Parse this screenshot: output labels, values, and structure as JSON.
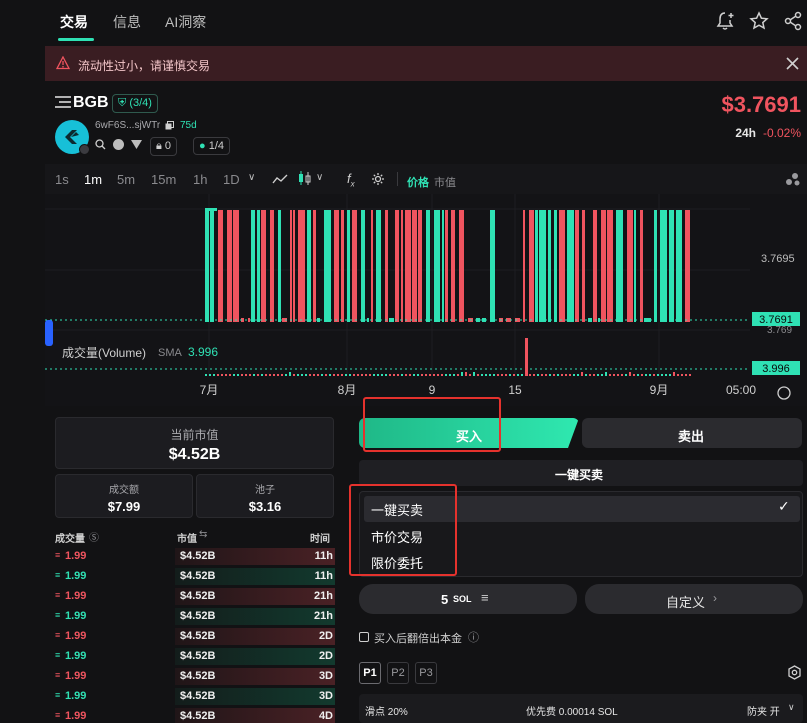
{
  "topbar": {
    "tabs": [
      {
        "label": "交易"
      },
      {
        "label": "信息"
      },
      {
        "label": "AI洞察"
      }
    ],
    "icons": [
      "bell-plus-icon",
      "star-icon",
      "share-icon"
    ]
  },
  "warning": {
    "text": "流动性过小，请谨慎交易",
    "icon": "warning-triangle-icon"
  },
  "token": {
    "symbol": "BGB",
    "badge": "(3/4)",
    "address": "6wF6S...sjWTr",
    "age": "75d",
    "holders_count": "0",
    "ratio": "1/4",
    "price": "$3.7691",
    "change_label": "24h",
    "change": "-0.02%"
  },
  "timeframes": [
    {
      "label": "1s"
    },
    {
      "label": "1m"
    },
    {
      "label": "5m"
    },
    {
      "label": "15m"
    },
    {
      "label": "1h"
    },
    {
      "label": "1D"
    }
  ],
  "chart_toggle": {
    "price": "价格",
    "mcap": "市值"
  },
  "chart_data": {
    "type": "bar",
    "price_ticks": [
      "3.7695",
      "3.7691",
      "3.769"
    ],
    "price_current_label": "3.7691",
    "volume_label": "成交量(Volume)",
    "volume_sma_label": "SMA",
    "volume_sma_value": "3.996",
    "volume_current_label": "3.996",
    "x_ticks": [
      "7月",
      "8月",
      "9",
      "15",
      "9月",
      "05:00"
    ]
  },
  "stats": {
    "mcap_label": "当前市值",
    "mcap_value": "$4.52B",
    "volume_label": "成交额",
    "volume_value": "$7.99",
    "pool_label": "池子",
    "pool_value": "$3.16"
  },
  "trades": {
    "headers": {
      "amount": "成交量",
      "mcap": "市值",
      "time": "时间"
    },
    "rows": [
      {
        "amount": "1.99",
        "mcap": "$4.52B",
        "time": "11h",
        "side": "sell"
      },
      {
        "amount": "1.99",
        "mcap": "$4.52B",
        "time": "11h",
        "side": "buy"
      },
      {
        "amount": "1.99",
        "mcap": "$4.52B",
        "time": "21h",
        "side": "sell"
      },
      {
        "amount": "1.99",
        "mcap": "$4.52B",
        "time": "21h",
        "side": "buy"
      },
      {
        "amount": "1.99",
        "mcap": "$4.52B",
        "time": "2D",
        "side": "sell"
      },
      {
        "amount": "1.99",
        "mcap": "$4.52B",
        "time": "2D",
        "side": "buy"
      },
      {
        "amount": "1.99",
        "mcap": "$4.52B",
        "time": "3D",
        "side": "sell"
      },
      {
        "amount": "1.99",
        "mcap": "$4.52B",
        "time": "3D",
        "side": "buy"
      },
      {
        "amount": "1.99",
        "mcap": "$4.52B",
        "time": "4D",
        "side": "sell"
      }
    ]
  },
  "order": {
    "buy_label": "买入",
    "sell_label": "卖出",
    "mode_selected": "一键买卖",
    "mode_options": [
      "一键买卖",
      "市价交易",
      "限价委托"
    ],
    "amount": "5",
    "amount_unit": "SOL",
    "custom_label": "自定义",
    "double_label": "买入后翻倍出本金",
    "presets": [
      "P1",
      "P2",
      "P3"
    ],
    "slippage": "滑点 20%",
    "priority": "优先费 0.00014 SOL",
    "mev": "防夹 开"
  },
  "colors": {
    "green": "#2fe1b4",
    "red": "#f0545f",
    "warn_bg": "#3a1d22"
  }
}
